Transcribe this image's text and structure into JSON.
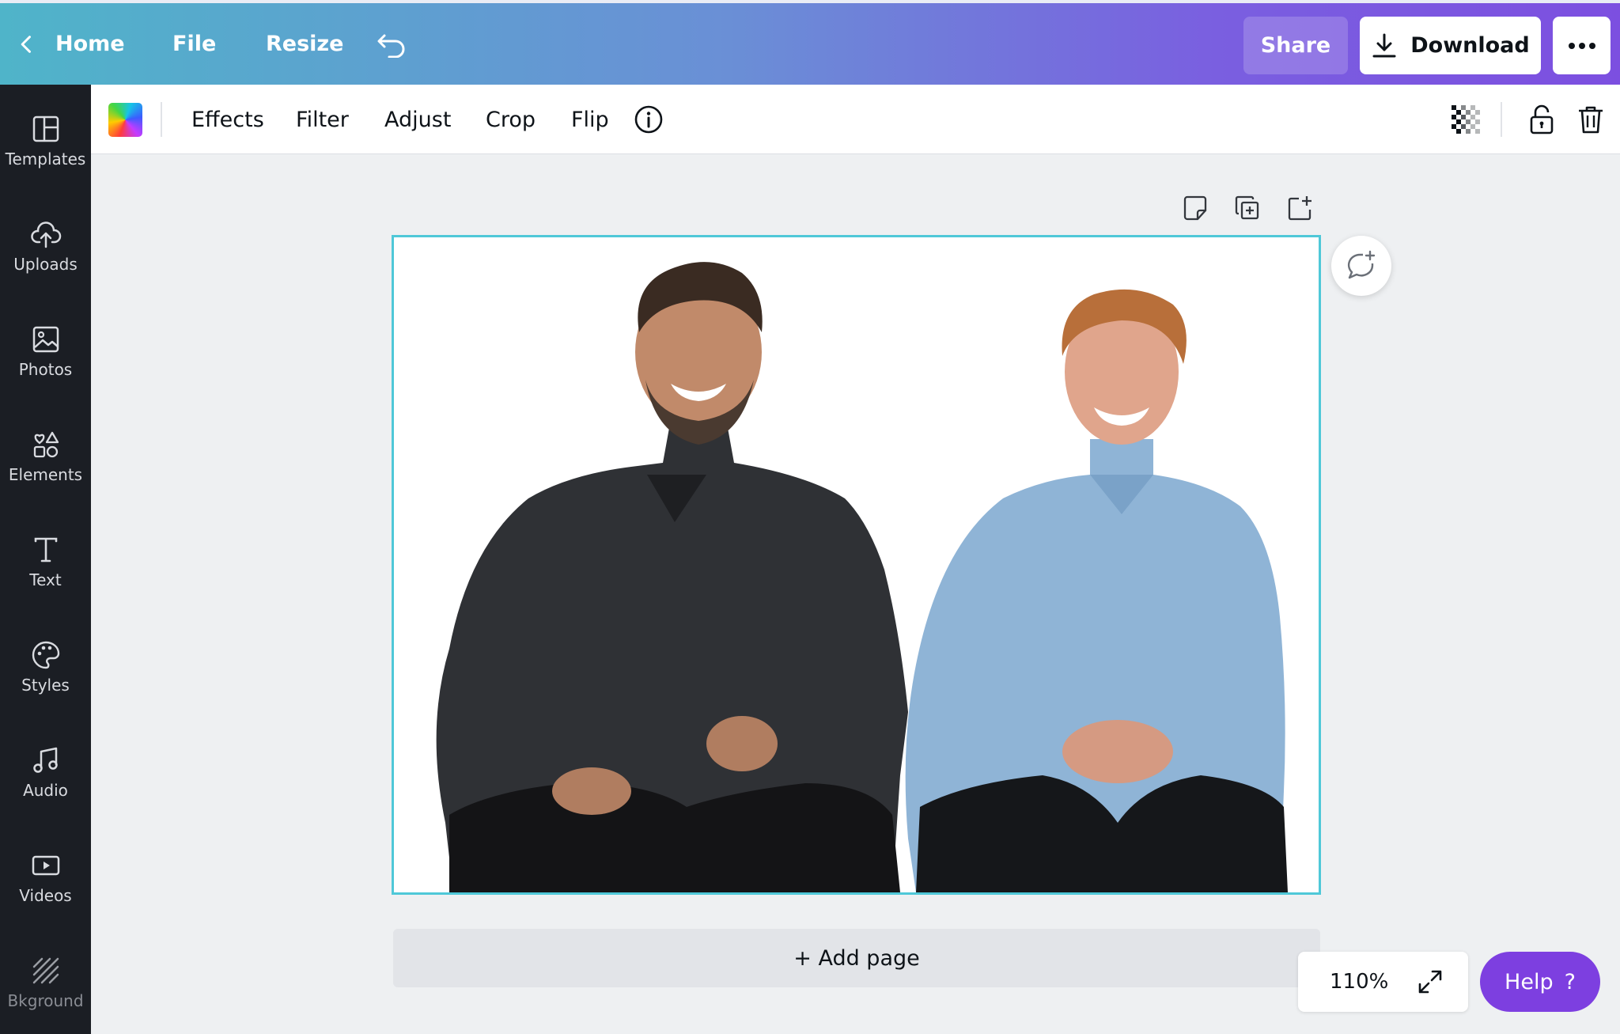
{
  "topbar": {
    "home_label": "Home",
    "file_label": "File",
    "resize_label": "Resize",
    "share_label": "Share",
    "download_label": "Download"
  },
  "sidebar": {
    "items": [
      {
        "label": "Templates",
        "icon": "templates-icon"
      },
      {
        "label": "Uploads",
        "icon": "upload-cloud-icon"
      },
      {
        "label": "Photos",
        "icon": "photos-icon"
      },
      {
        "label": "Elements",
        "icon": "elements-icon"
      },
      {
        "label": "Text",
        "icon": "text-icon"
      },
      {
        "label": "Styles",
        "icon": "palette-icon"
      },
      {
        "label": "Audio",
        "icon": "music-note-icon"
      },
      {
        "label": "Videos",
        "icon": "video-icon"
      },
      {
        "label": "Bkground",
        "icon": "background-icon"
      }
    ]
  },
  "toolbar": {
    "effects": "Effects",
    "filter": "Filter",
    "adjust": "Adjust",
    "crop": "Crop",
    "flip": "Flip"
  },
  "canvas": {
    "add_page_label": "+ Add page",
    "selection_color": "#4fc8d8"
  },
  "footer": {
    "zoom": "110%",
    "help_label": "Help",
    "help_glyph": "?"
  },
  "colors": {
    "accent": "#7d3fe0",
    "sidebar_bg": "#1b1e24"
  }
}
